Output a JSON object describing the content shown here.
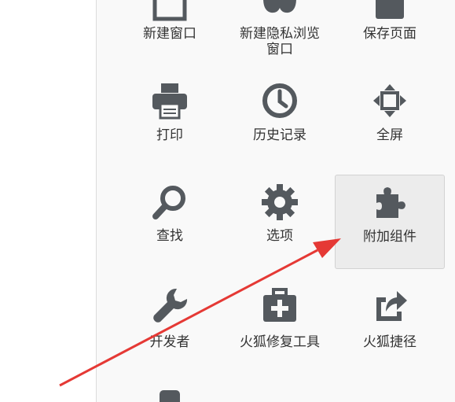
{
  "menu": {
    "items": [
      {
        "label": "新建窗口",
        "icon": "new-window-icon"
      },
      {
        "label": "新建隐私浏览",
        "label2": "窗口",
        "icon": "private-window-icon"
      },
      {
        "label": "保存页面",
        "icon": "save-page-icon"
      },
      {
        "label": "打印",
        "icon": "print-icon"
      },
      {
        "label": "历史记录",
        "icon": "history-icon"
      },
      {
        "label": "全屏",
        "icon": "fullscreen-icon"
      },
      {
        "label": "查找",
        "icon": "search-icon"
      },
      {
        "label": "选项",
        "icon": "gear-icon"
      },
      {
        "label": "附加组件",
        "icon": "puzzle-icon"
      },
      {
        "label": "开发者",
        "icon": "wrench-icon"
      },
      {
        "label": "火狐修复工具",
        "icon": "medkit-icon"
      },
      {
        "label": "火狐捷径",
        "icon": "share-icon"
      }
    ]
  },
  "colors": {
    "icon": "#54595e",
    "panel_bg": "#f9f9f9",
    "highlight_bg": "#ececec",
    "arrow": "#e53935"
  }
}
